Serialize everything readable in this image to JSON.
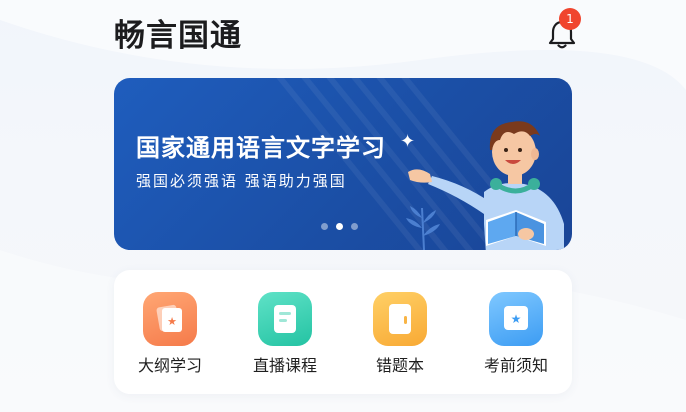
{
  "header": {
    "title": "畅言国通",
    "notification_count": "1"
  },
  "banner": {
    "title": "国家通用语言文字学习",
    "subtitle": "强国必须强语  强语助力强国",
    "slide_count": 3,
    "active_slide": 2
  },
  "menu": {
    "items": [
      {
        "label": "大纲学习",
        "icon": "star-card-icon",
        "color": "#f57a4a"
      },
      {
        "label": "直播课程",
        "icon": "document-icon",
        "color": "#24c3a3"
      },
      {
        "label": "错题本",
        "icon": "notebook-icon",
        "color": "#f8a934"
      },
      {
        "label": "考前须知",
        "icon": "star-badge-icon",
        "color": "#3c9cf3"
      }
    ]
  },
  "colors": {
    "banner_blue": "#1f5dbd",
    "badge_red": "#f0452e"
  }
}
